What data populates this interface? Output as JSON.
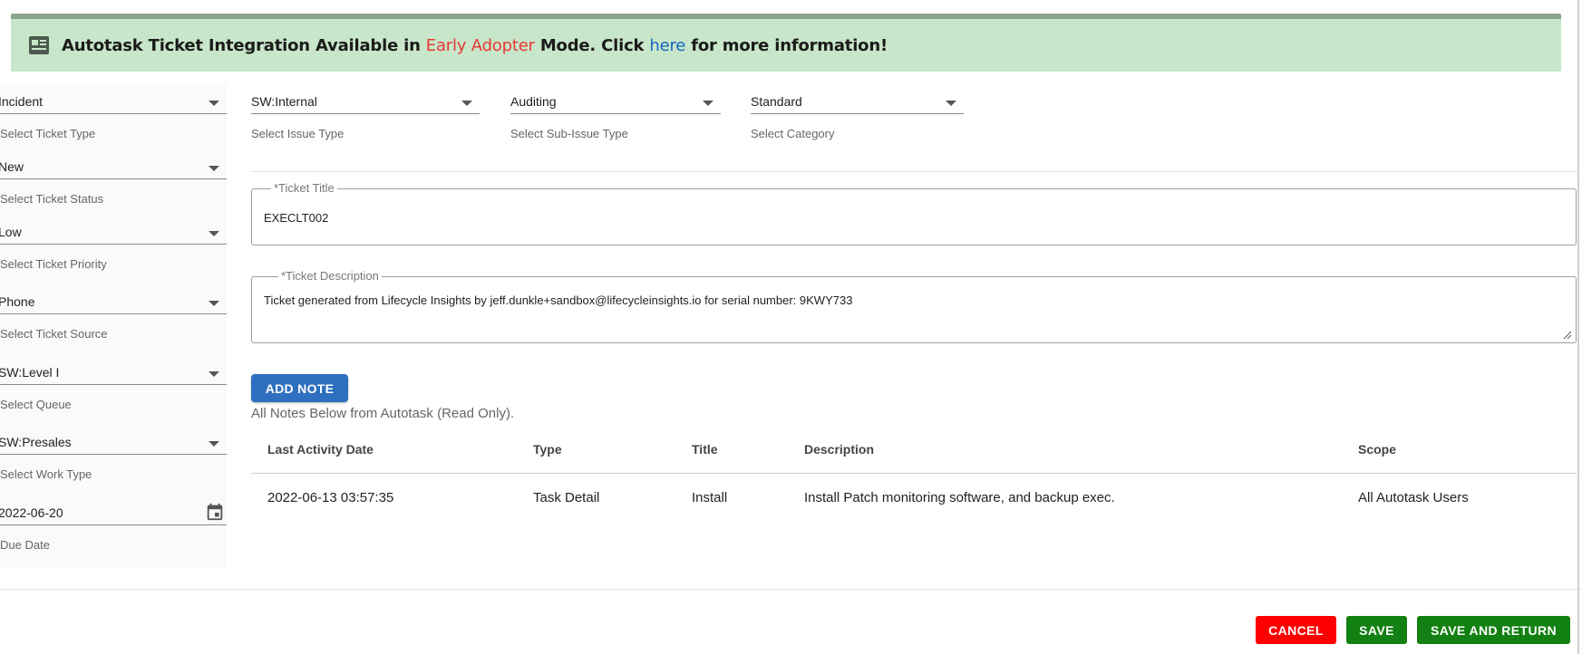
{
  "banner": {
    "icon": "article-icon",
    "text_before": "Autotask Ticket Integration Available in ",
    "highlight": "Early Adopter",
    "text_middle": " Mode. Click ",
    "link": "here",
    "text_after": " for more information!",
    "colors": {
      "background": "#c8e6c9",
      "highlight": "#e53935",
      "link": "#1565c0"
    }
  },
  "left_fields": [
    {
      "value": "Incident",
      "helper": "Select Ticket Type"
    },
    {
      "value": "New",
      "helper": "Select Ticket Status"
    },
    {
      "value": "Low",
      "helper": "Select Ticket Priority"
    },
    {
      "value": "Phone",
      "helper": "Select Ticket Source"
    },
    {
      "value": "SW:Level I",
      "helper": "Select Queue"
    },
    {
      "value": "SW:Presales",
      "helper": "Select Work Type"
    },
    {
      "value": "2022-06-20",
      "helper": "Due Date"
    }
  ],
  "top_fields": [
    {
      "value": "SW:Internal",
      "helper": "Select Issue Type"
    },
    {
      "value": "Auditing",
      "helper": "Select Sub-Issue Type"
    },
    {
      "value": "Standard",
      "helper": "Select Category"
    }
  ],
  "ticket_title": {
    "label": "*Ticket Title",
    "value": "EXECLT002"
  },
  "ticket_description": {
    "label": "*Ticket Description",
    "value": "Ticket generated from Lifecycle Insights by jeff.dunkle+sandbox@lifecycleinsights.io for serial number: 9KWY733"
  },
  "notes": {
    "add_button": "ADD NOTE",
    "caption": "All Notes Below from Autotask (Read Only).",
    "columns": [
      "Last Activity Date",
      "Type",
      "Title",
      "Description",
      "Scope"
    ],
    "rows": [
      [
        "2022-06-13 03:57:35",
        "Task Detail",
        "Install",
        "Install Patch monitoring software, and backup exec.",
        "All Autotask Users"
      ]
    ]
  },
  "actions": {
    "cancel": "CANCEL",
    "save": "SAVE",
    "save_and_return": "SAVE AND RETURN",
    "colors": {
      "cancel": "#ff0000",
      "save": "#128012",
      "primary": "#2e6fbf"
    }
  }
}
